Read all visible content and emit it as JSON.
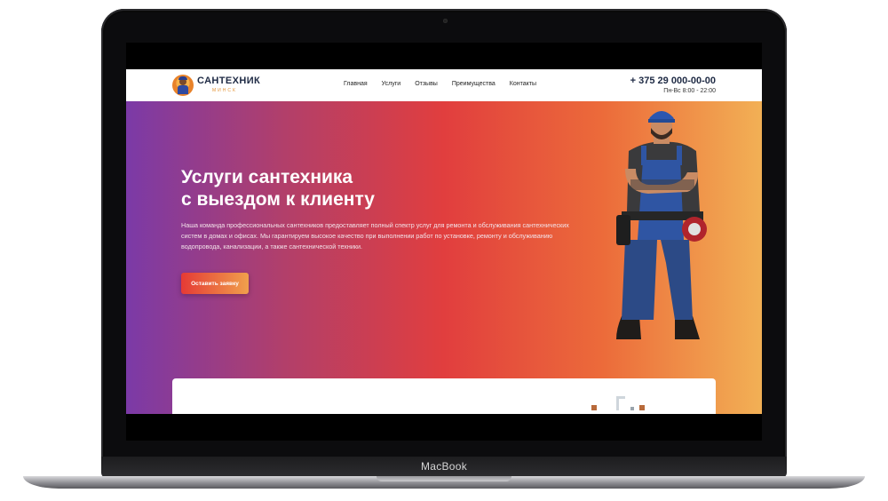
{
  "device": {
    "label": "MacBook"
  },
  "site": {
    "logo": {
      "title": "САНТЕХНИК",
      "subtitle": "МИНСК"
    },
    "nav": [
      "Главная",
      "Услуги",
      "Отзывы",
      "Преимущества",
      "Контакты"
    ],
    "contact": {
      "phone": "+ 375 29 000-00-00",
      "hours": "Пн-Вс 8:00 - 22:00"
    },
    "hero": {
      "title_line1": "Услуги сантехника",
      "title_line2": "с выездом к клиенту",
      "text": "Наша команда профессиональных сантехников предоставляет полный спектр услуг для ремонта и обслуживания сантехнических систем в домах и офисах. Мы гарантируем высокое качество при выполнении работ по установке, ремонту и обслуживанию водопровода, канализации, а также сантехнической техники.",
      "cta": "Оставить заявку"
    }
  },
  "colors": {
    "gradient": [
      "#7b3aa7",
      "#e13e3e",
      "#f2b055"
    ],
    "accent": "#e39234",
    "dark_text": "#1e2a44"
  },
  "icons": [
    "plumber-logo-icon",
    "plumber-worker-image"
  ]
}
